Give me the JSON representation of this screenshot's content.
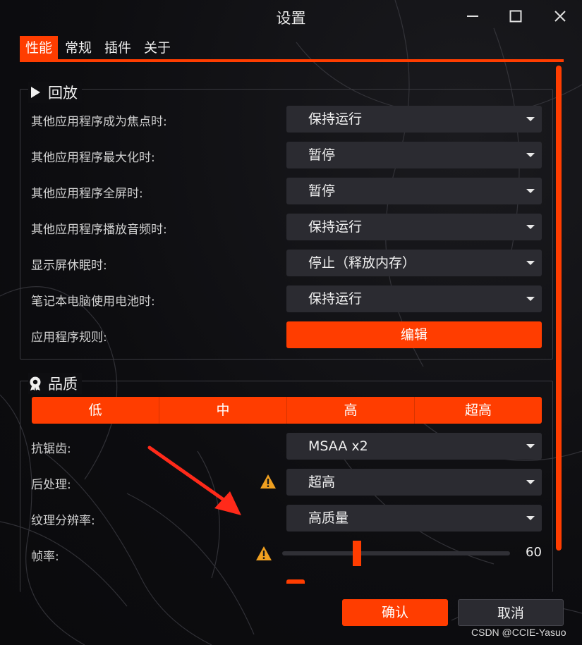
{
  "window": {
    "title": "设置"
  },
  "tabs": [
    {
      "label": "性能",
      "active": true
    },
    {
      "label": "常规",
      "active": false
    },
    {
      "label": "插件",
      "active": false
    },
    {
      "label": "关于",
      "active": false
    }
  ],
  "playback": {
    "title": "回放",
    "rows": [
      {
        "label": "其他应用程序成为焦点时:",
        "value": "保持运行"
      },
      {
        "label": "其他应用程序最大化时:",
        "value": "暂停"
      },
      {
        "label": "其他应用程序全屏时:",
        "value": "暂停"
      },
      {
        "label": "其他应用程序播放音频时:",
        "value": "保持运行"
      },
      {
        "label": "显示屏休眠时:",
        "value": "停止（释放内存）"
      },
      {
        "label": "笔记本电脑使用电池时:",
        "value": "保持运行"
      }
    ],
    "app_rules_label": "应用程序规则:",
    "edit_button": "编辑"
  },
  "quality": {
    "title": "品质",
    "presets": [
      "低",
      "中",
      "高",
      "超高"
    ],
    "antialias_label": "抗锯齿:",
    "antialias_value": "MSAA x2",
    "postprocess_label": "后处理:",
    "postprocess_value": "超高",
    "texture_label": "纹理分辨率:",
    "texture_value": "高质量",
    "framerate_label": "帧率:",
    "framerate_value": "60"
  },
  "footer": {
    "ok": "确认",
    "cancel": "取消"
  },
  "watermark": "CSDN @CCIE-Yasuo",
  "colors": {
    "accent": "#ff3d00",
    "background": "#0f0f12",
    "control": "#2b2b31",
    "warning": "#f0a020"
  }
}
